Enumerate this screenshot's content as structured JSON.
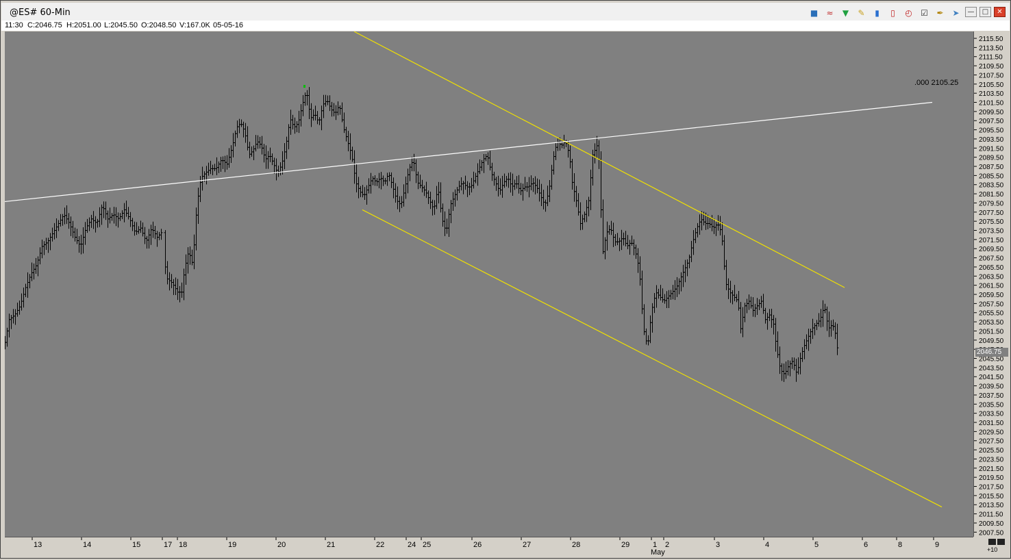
{
  "window": {
    "title": "@ES# 60-Min",
    "toolbar_icons": [
      "cash-ticket-icon",
      "rainbow-icon",
      "gift-funnel-icon",
      "pencil-icon",
      "bar-chart-icon",
      "candlestick-icon",
      "clock-icon",
      "checklist-icon",
      "pen-tool-icon",
      "pin-icon"
    ],
    "minimize": "—",
    "restore": "□",
    "close": "✕"
  },
  "status": {
    "time": "11:30",
    "close": "C:2046.75",
    "high": "H:2051.00",
    "low": "L:2045.50",
    "open": "O:2048.50",
    "volume": "V:167.0K",
    "date": "05-05-16"
  },
  "annotation": {
    "text": ".000  2105.25"
  },
  "last_price": "2046.75",
  "corner": {
    "label": "+10"
  },
  "colors": {
    "plot_bg": "#808080",
    "bars": "#000000",
    "channel_lines": "#f0e000",
    "trend_line": "#ffffff",
    "high_marker": "#00c000"
  },
  "chart_data": {
    "type": "ohlc-bar",
    "instrument": "@ES#",
    "interval": "60-Min",
    "ylim": [
      2006.5,
      2117.0
    ],
    "ytick_labels": [
      "2115.50",
      "2113.50",
      "2111.50",
      "2109.50",
      "2107.50",
      "2105.50",
      "2103.50",
      "2101.50",
      "2099.50",
      "2097.50",
      "2095.50",
      "2093.50",
      "2091.50",
      "2089.50",
      "2087.50",
      "2085.50",
      "2083.50",
      "2081.50",
      "2079.50",
      "2077.50",
      "2075.50",
      "2073.50",
      "2071.50",
      "2069.50",
      "2067.50",
      "2065.50",
      "2063.50",
      "2061.50",
      "2059.50",
      "2057.50",
      "2055.50",
      "2053.50",
      "2051.50",
      "2049.50",
      "2047.50",
      "2045.50",
      "2043.50",
      "2041.50",
      "2039.50",
      "2037.50",
      "2035.50",
      "2033.50",
      "2031.50",
      "2029.50",
      "2027.50",
      "2025.50",
      "2023.50",
      "2021.50",
      "2019.50",
      "2017.50",
      "2015.50",
      "2013.50",
      "2011.50",
      "2009.50",
      "2007.50"
    ],
    "xtick_labels": [
      "13",
      "14",
      "15",
      "17",
      "18",
      "19",
      "20",
      "21",
      "22",
      "24",
      "25",
      "26",
      "27",
      "28",
      "29",
      "1",
      "2",
      "3",
      "4",
      "5",
      "6",
      "8",
      "9"
    ],
    "month_label": "May",
    "price_path": [
      [
        0,
        2049
      ],
      [
        6,
        2054
      ],
      [
        14,
        2055
      ],
      [
        22,
        2057
      ],
      [
        30,
        2061
      ],
      [
        38,
        2064
      ],
      [
        46,
        2066
      ],
      [
        54,
        2070
      ],
      [
        62,
        2071
      ],
      [
        70,
        2073
      ],
      [
        78,
        2075
      ],
      [
        86,
        2077
      ],
      [
        94,
        2075
      ],
      [
        102,
        2072
      ],
      [
        110,
        2070
      ],
      [
        118,
        2074
      ],
      [
        126,
        2076
      ],
      [
        134,
        2075
      ],
      [
        142,
        2079
      ],
      [
        150,
        2076
      ],
      [
        158,
        2077
      ],
      [
        166,
        2076
      ],
      [
        174,
        2078
      ],
      [
        182,
        2076
      ],
      [
        190,
        2073
      ],
      [
        198,
        2074
      ],
      [
        206,
        2071
      ],
      [
        214,
        2074
      ],
      [
        222,
        2072
      ],
      [
        228,
        2073
      ],
      [
        236,
        2063
      ],
      [
        244,
        2062
      ],
      [
        252,
        2060
      ],
      [
        258,
        2060
      ],
      [
        262,
        2065
      ],
      [
        268,
        2069
      ],
      [
        274,
        2066
      ],
      [
        280,
        2079
      ],
      [
        286,
        2085
      ],
      [
        292,
        2086
      ],
      [
        300,
        2087
      ],
      [
        308,
        2087
      ],
      [
        316,
        2089
      ],
      [
        324,
        2088
      ],
      [
        332,
        2092
      ],
      [
        338,
        2096
      ],
      [
        344,
        2097
      ],
      [
        350,
        2095
      ],
      [
        356,
        2090
      ],
      [
        362,
        2091
      ],
      [
        368,
        2093
      ],
      [
        374,
        2092
      ],
      [
        380,
        2089
      ],
      [
        386,
        2090
      ],
      [
        392,
        2088
      ],
      [
        398,
        2086
      ],
      [
        404,
        2088
      ],
      [
        410,
        2092
      ],
      [
        416,
        2098
      ],
      [
        422,
        2096
      ],
      [
        428,
        2097
      ],
      [
        434,
        2101
      ],
      [
        440,
        2104
      ],
      [
        446,
        2098
      ],
      [
        452,
        2099
      ],
      [
        458,
        2097
      ],
      [
        464,
        2101
      ],
      [
        470,
        2102
      ],
      [
        476,
        2100
      ],
      [
        482,
        2099
      ],
      [
        488,
        2101
      ],
      [
        494,
        2096
      ],
      [
        500,
        2093
      ],
      [
        506,
        2090
      ],
      [
        512,
        2084
      ],
      [
        518,
        2082
      ],
      [
        524,
        2081
      ],
      [
        530,
        2083
      ],
      [
        536,
        2085
      ],
      [
        542,
        2084
      ],
      [
        548,
        2085
      ],
      [
        554,
        2084
      ],
      [
        560,
        2086
      ],
      [
        566,
        2083
      ],
      [
        572,
        2080
      ],
      [
        578,
        2079
      ],
      [
        584,
        2083
      ],
      [
        590,
        2087
      ],
      [
        596,
        2089
      ],
      [
        602,
        2084
      ],
      [
        608,
        2083
      ],
      [
        614,
        2082
      ],
      [
        620,
        2080
      ],
      [
        626,
        2078
      ],
      [
        632,
        2083
      ],
      [
        638,
        2076
      ],
      [
        644,
        2073
      ],
      [
        650,
        2079
      ],
      [
        656,
        2081
      ],
      [
        662,
        2083
      ],
      [
        668,
        2084
      ],
      [
        674,
        2083
      ],
      [
        680,
        2083
      ],
      [
        686,
        2085
      ],
      [
        692,
        2087
      ],
      [
        698,
        2089
      ],
      [
        704,
        2090
      ],
      [
        710,
        2086
      ],
      [
        716,
        2084
      ],
      [
        722,
        2082
      ],
      [
        728,
        2084
      ],
      [
        734,
        2085
      ],
      [
        740,
        2083
      ],
      [
        746,
        2084
      ],
      [
        752,
        2082
      ],
      [
        758,
        2083
      ],
      [
        764,
        2083
      ],
      [
        770,
        2084
      ],
      [
        776,
        2083
      ],
      [
        782,
        2081
      ],
      [
        788,
        2079
      ],
      [
        794,
        2082
      ],
      [
        800,
        2089
      ],
      [
        806,
        2093
      ],
      [
        812,
        2092
      ],
      [
        818,
        2093
      ],
      [
        824,
        2090
      ],
      [
        828,
        2084
      ],
      [
        834,
        2080
      ],
      [
        840,
        2075
      ],
      [
        846,
        2077
      ],
      [
        852,
        2080
      ],
      [
        858,
        2090
      ],
      [
        864,
        2092
      ],
      [
        868,
        2088
      ],
      [
        872,
        2068
      ],
      [
        878,
        2073
      ],
      [
        884,
        2074
      ],
      [
        890,
        2071
      ],
      [
        896,
        2071
      ],
      [
        902,
        2072
      ],
      [
        908,
        2070
      ],
      [
        914,
        2071
      ],
      [
        920,
        2069
      ],
      [
        926,
        2065
      ],
      [
        932,
        2052
      ],
      [
        938,
        2048
      ],
      [
        944,
        2056
      ],
      [
        950,
        2060
      ],
      [
        956,
        2059
      ],
      [
        962,
        2058
      ],
      [
        968,
        2059
      ],
      [
        974,
        2060
      ],
      [
        980,
        2061
      ],
      [
        986,
        2063
      ],
      [
        992,
        2065
      ],
      [
        998,
        2067
      ],
      [
        1004,
        2071
      ],
      [
        1010,
        2074
      ],
      [
        1016,
        2076
      ],
      [
        1022,
        2075
      ],
      [
        1028,
        2075
      ],
      [
        1034,
        2074
      ],
      [
        1040,
        2075
      ],
      [
        1046,
        2073
      ],
      [
        1052,
        2062
      ],
      [
        1058,
        2060
      ],
      [
        1064,
        2059
      ],
      [
        1070,
        2058
      ],
      [
        1074,
        2052
      ],
      [
        1080,
        2057
      ],
      [
        1086,
        2058
      ],
      [
        1092,
        2056
      ],
      [
        1098,
        2057
      ],
      [
        1104,
        2058
      ],
      [
        1110,
        2054
      ],
      [
        1116,
        2055
      ],
      [
        1122,
        2053
      ],
      [
        1126,
        2048
      ],
      [
        1132,
        2043
      ],
      [
        1138,
        2042
      ],
      [
        1144,
        2044
      ],
      [
        1150,
        2045
      ],
      [
        1156,
        2042
      ],
      [
        1160,
        2045
      ],
      [
        1166,
        2048
      ],
      [
        1172,
        2050
      ],
      [
        1178,
        2052
      ],
      [
        1184,
        2053
      ],
      [
        1190,
        2054
      ],
      [
        1196,
        2057
      ],
      [
        1202,
        2052
      ],
      [
        1208,
        2053
      ],
      [
        1212,
        2051
      ],
      [
        1216,
        2046.75
      ]
    ],
    "lines": [
      {
        "name": "yellow-channel-upper",
        "color": "#f0e000",
        "points": [
          [
            510,
            2117
          ],
          [
            1226,
            2061
          ]
        ]
      },
      {
        "name": "yellow-channel-lower",
        "color": "#f0e000",
        "points": [
          [
            522,
            2078
          ],
          [
            1368,
            2013
          ]
        ]
      },
      {
        "name": "white-trendline",
        "color": "#ffffff",
        "points": [
          [
            0,
            2079.8
          ],
          [
            1354,
            2101.5
          ]
        ]
      }
    ]
  }
}
